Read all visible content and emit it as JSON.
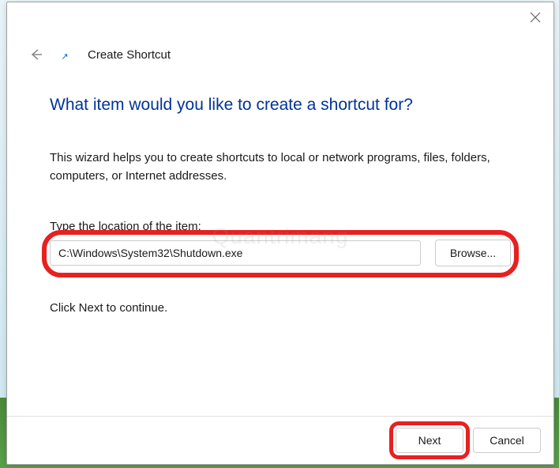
{
  "dialog": {
    "title": "Create Shortcut",
    "heading": "What item would you like to create a shortcut for?",
    "description": "This wizard helps you to create shortcuts to local or network programs, files, folders, computers, or Internet addresses.",
    "location_label": "Type the location of the item:",
    "location_value": "C:\\Windows\\System32\\Shutdown.exe",
    "browse_label": "Browse...",
    "continue_text": "Click Next to continue.",
    "next_label": "Next",
    "cancel_label": "Cancel"
  },
  "watermark": "Quantrimang"
}
